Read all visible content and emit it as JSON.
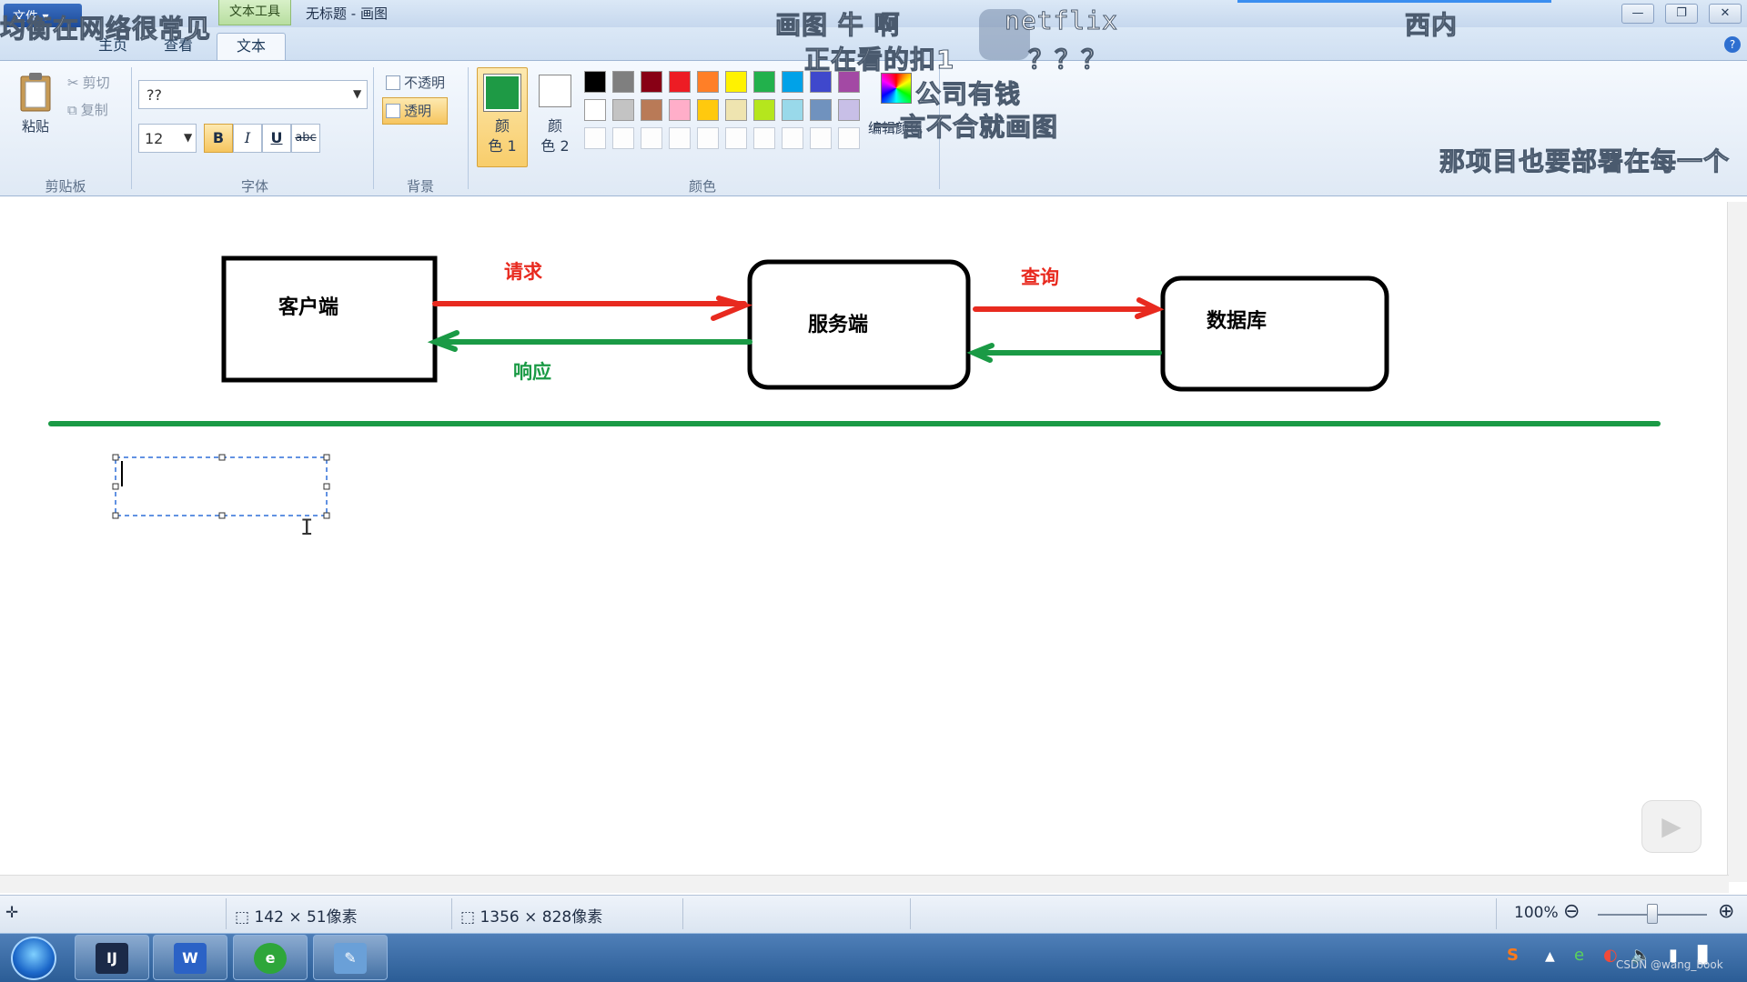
{
  "app": {
    "quick_access": "文件",
    "context_tab": "文本工具",
    "window_title": "无标题 - 画图",
    "window_buttons": [
      "—",
      "❐",
      "✕"
    ],
    "help": "?"
  },
  "tabs": [
    {
      "label": "主页",
      "active": false
    },
    {
      "label": "查看",
      "active": false
    },
    {
      "label": "文本",
      "active": true
    }
  ],
  "clipboard": {
    "paste": "粘贴",
    "cut": "剪切",
    "copy": "复制",
    "group": "剪贴板"
  },
  "font": {
    "name": "??",
    "size": "12",
    "bold": "B",
    "italic": "I",
    "underline": "U",
    "strike": "abc",
    "group": "字体"
  },
  "background": {
    "opaque": "不透明",
    "transparent": "透明",
    "group": "背景"
  },
  "colors": {
    "color1_label": "颜\n色 1",
    "color2_label": "颜\n色 2",
    "color1_value": "#1e9a45",
    "edit": "编辑颜色",
    "group": "颜色",
    "palette_row1": [
      "#000000",
      "#7f7f7f",
      "#880015",
      "#ed1c24",
      "#ff7f27",
      "#fff200",
      "#22b14c",
      "#00a2e8",
      "#3f48cc",
      "#a349a4"
    ],
    "palette_row2": [
      "#ffffff",
      "#c3c3c3",
      "#b97a57",
      "#ffaec9",
      "#ffc90e",
      "#efe4b0",
      "#b5e61d",
      "#99d9ea",
      "#7092be",
      "#c8bfe7"
    ],
    "palette_row3": [
      "#fdfdfd",
      "#fdfdfd",
      "#fdfdfd",
      "#fdfdfd",
      "#fdfdfd",
      "#fdfdfd",
      "#fdfdfd",
      "#fdfdfd",
      "#fdfdfd",
      "#fdfdfd"
    ]
  },
  "overlays": {
    "c1": "均衡在网络很常见",
    "c2": "画图 牛 啊",
    "c3": "netflix",
    "c4": "正在看的扣1",
    "c5": "？？？",
    "c6": "西内",
    "c7": "公司有钱",
    "c8": "一言不合就画图",
    "c9": "那项目也要部署在每一个"
  },
  "diagram": {
    "client": "客户端",
    "server": "服务端",
    "database": "数据库",
    "request": "请求",
    "response": "响应",
    "query": "查询",
    "red": "#e82a1f",
    "green": "#1a9a45"
  },
  "status": {
    "move_icon": "✛",
    "selection": "142 × 51像素",
    "canvas_size": "1356 × 828像素",
    "zoom": "100%",
    "zoom_out": "⊖",
    "zoom_in": "⊕"
  },
  "taskbar": {
    "apps": [
      {
        "label": "IJ",
        "color": "#1b2a48"
      },
      {
        "label": "W",
        "color": "#2b62c6"
      },
      {
        "label": "e",
        "color": "#2ea63a"
      },
      {
        "label": "✎",
        "color": "#6aa0d8"
      }
    ],
    "tray": [
      "S",
      "▲",
      "e",
      "◐",
      "🔈",
      "▮",
      "▊"
    ],
    "watermark": "CSDN @wang_book"
  }
}
